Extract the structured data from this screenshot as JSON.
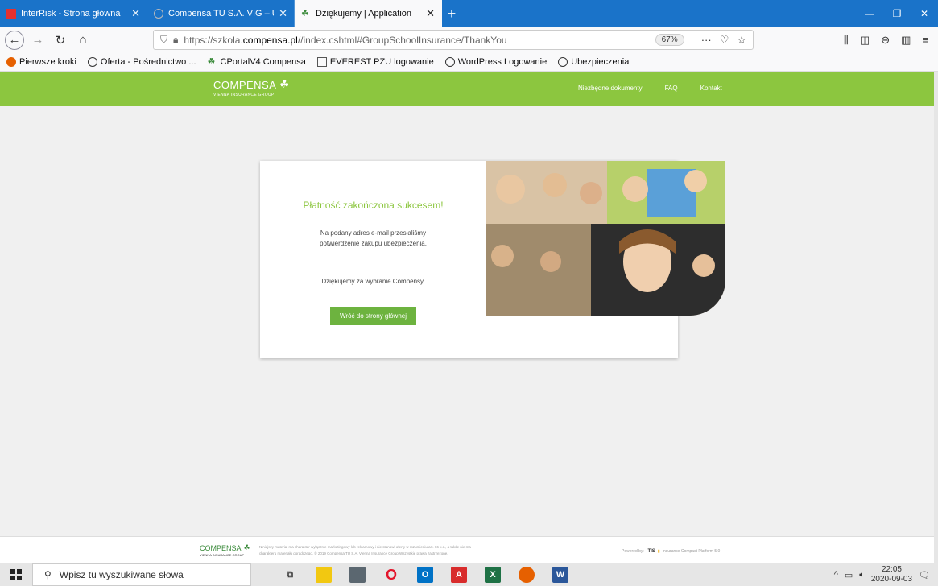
{
  "browser": {
    "tabs": [
      {
        "title": "InterRisk - Strona główna",
        "favicon_color": "#e4312f"
      },
      {
        "title": "Compensa TU S.A. VIG – Ubezp",
        "favicon_color": "#bbbbbb"
      },
      {
        "title": "Dziękujemy | Application",
        "favicon_color": "#3a8a3a"
      }
    ],
    "url_prefix": "https://szkola.",
    "url_domain": "compensa.pl",
    "url_suffix": "//index.cshtml#GroupSchoolInsurance/ThankYou",
    "zoom": "67%",
    "bookmarks": [
      {
        "label": "Pierwsze kroki",
        "icon": "firefox-icon"
      },
      {
        "label": "Oferta - Pośrednictwo ...",
        "icon": "globe-icon"
      },
      {
        "label": "CPortalV4 Compensa",
        "icon": "compensa-icon"
      },
      {
        "label": "EVEREST PZU logowanie",
        "icon": "page-icon"
      },
      {
        "label": "WordPress Logowanie",
        "icon": "globe-icon"
      },
      {
        "label": "Ubezpieczenia",
        "icon": "globe-icon"
      }
    ]
  },
  "site": {
    "logo_text": "COMPENSA",
    "logo_sub": "VIENNA INSURANCE GROUP",
    "nav": [
      "Niezbędne dokumenty",
      "FAQ",
      "Kontakt"
    ],
    "brand_color": "#8cc63f"
  },
  "card": {
    "title": "Płatność zakończona sukcesem!",
    "line1": "Na podany adres e-mail przesłaliśmy",
    "line2": "potwierdzenie zakupu ubezpieczenia.",
    "thanks": "Dziękujemy za wybranie Compensy.",
    "button": "Wróć do strony głównej"
  },
  "footer": {
    "logo_text": "COMPENSA",
    "logo_sub": "VIENNA INSURANCE GROUP",
    "note1": "Niniejszy materiał ma charakter wyłącznie marketingowy lub reklamowy i nie stanowi oferty w rozumieniu art. 66 k.c., a także nie ma",
    "note2": "charakteru materiału doradczego. © 2019 Compensa TU S.A. Vienna Insurance Group Wszystkie prawa zastrzeżone.",
    "powered_label": "Powered by:",
    "powered_brand": "ITIS",
    "powered_product": "Insurance Compact Platform 5.0"
  },
  "taskbar": {
    "search_placeholder": "Wpisz tu wyszukiwane słowa",
    "time": "22:05",
    "date": "2020-09-03"
  }
}
